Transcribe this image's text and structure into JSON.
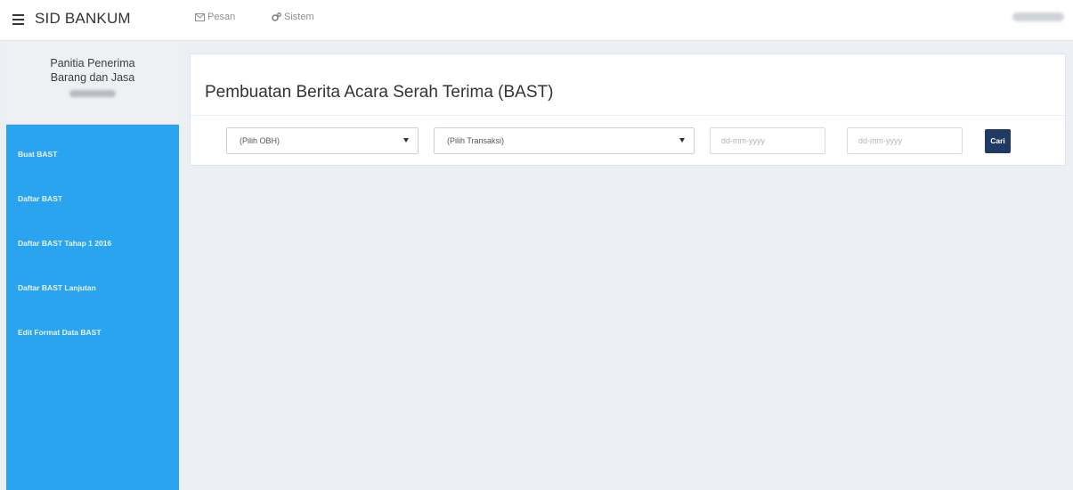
{
  "app": {
    "brand": "SID BANKUM"
  },
  "topnav": {
    "pesan_label": "Pesan",
    "sistem_label": "Sistem"
  },
  "sidebar": {
    "title_line1": "Panitia Penerima",
    "title_line2": "Barang dan Jasa",
    "items": [
      {
        "label": "Buat BAST"
      },
      {
        "label": "Daftar BAST"
      },
      {
        "label": "Daftar BAST Tahap 1 2016"
      },
      {
        "label": "Daftar BAST Lanjutan"
      },
      {
        "label": "Edit Format Data BAST"
      }
    ]
  },
  "main": {
    "title": "Pembuatan Berita Acara Serah Terima (BAST)",
    "filters": {
      "obh_selected": "(Pilih OBH)",
      "transaksi_selected": "(Pilih Transaksi)",
      "date_from_placeholder": "dd-mm-yyyy",
      "date_to_placeholder": "dd-mm-yyyy",
      "search_label": "Cari"
    }
  },
  "colors": {
    "sidebar": "#2aa4ef",
    "button": "#1f3b63",
    "background": "#eceff3"
  }
}
